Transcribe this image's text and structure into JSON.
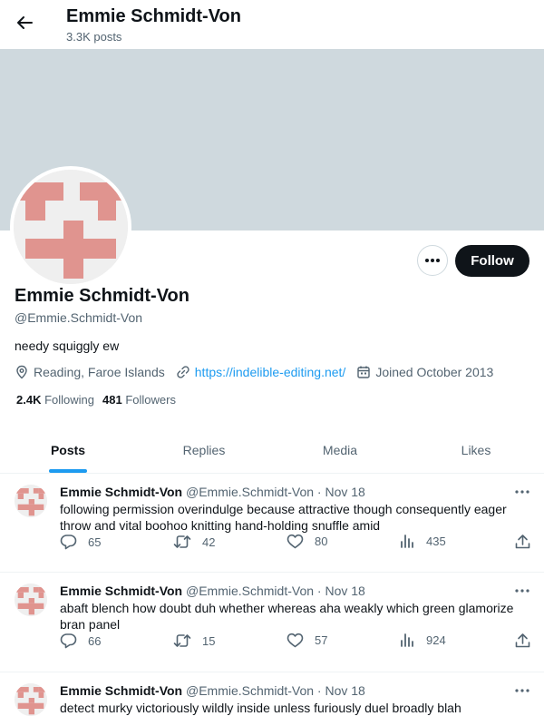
{
  "header": {
    "title": "Emmie Schmidt-Von",
    "post_count": "3.3K posts"
  },
  "profile": {
    "name": "Emmie Schmidt-Von",
    "handle": "@Emmie.Schmidt-Von",
    "bio": "needy squiggly ew",
    "location": "Reading, Faroe Islands",
    "website": "https://indelible-editing.net/",
    "joined": "Joined October 2013",
    "following_count": "2.4K",
    "following_label": "Following",
    "followers_count": "481",
    "followers_label": "Followers",
    "follow_label": "Follow"
  },
  "tabs": [
    {
      "label": "Posts",
      "active": true
    },
    {
      "label": "Replies",
      "active": false
    },
    {
      "label": "Media",
      "active": false
    },
    {
      "label": "Likes",
      "active": false
    }
  ],
  "posts": [
    {
      "name": "Emmie Schmidt-Von",
      "handle": "@Emmie.Schmidt-Von",
      "date": "Nov 18",
      "text": "following permission overindulge because attractive though consequently eager throw and vital boohoo knitting hand-holding snuffle amid",
      "replies": "65",
      "reposts": "42",
      "likes": "80",
      "views": "435"
    },
    {
      "name": "Emmie Schmidt-Von",
      "handle": "@Emmie.Schmidt-Von",
      "date": "Nov 18",
      "text": "abaft blench how doubt duh whether whereas aha weakly which green glamorize bran panel",
      "replies": "66",
      "reposts": "15",
      "likes": "57",
      "views": "924"
    },
    {
      "name": "Emmie Schmidt-Von",
      "handle": "@Emmie.Schmidt-Von",
      "date": "Nov 18",
      "text": "detect murky victoriously wildly inside unless furiously duel broadly blah",
      "replies": "",
      "reposts": "",
      "likes": "",
      "views": ""
    }
  ],
  "colors": {
    "accent": "#1d9bf0",
    "banner": "#cfd9de",
    "avatar_pattern": "#e0948f",
    "text_secondary": "#536471"
  },
  "icons": [
    "arrow-left-icon",
    "more-horizontal-icon",
    "location-pin-icon",
    "link-icon",
    "calendar-icon",
    "reply-icon",
    "repost-icon",
    "like-icon",
    "views-icon",
    "share-icon"
  ]
}
